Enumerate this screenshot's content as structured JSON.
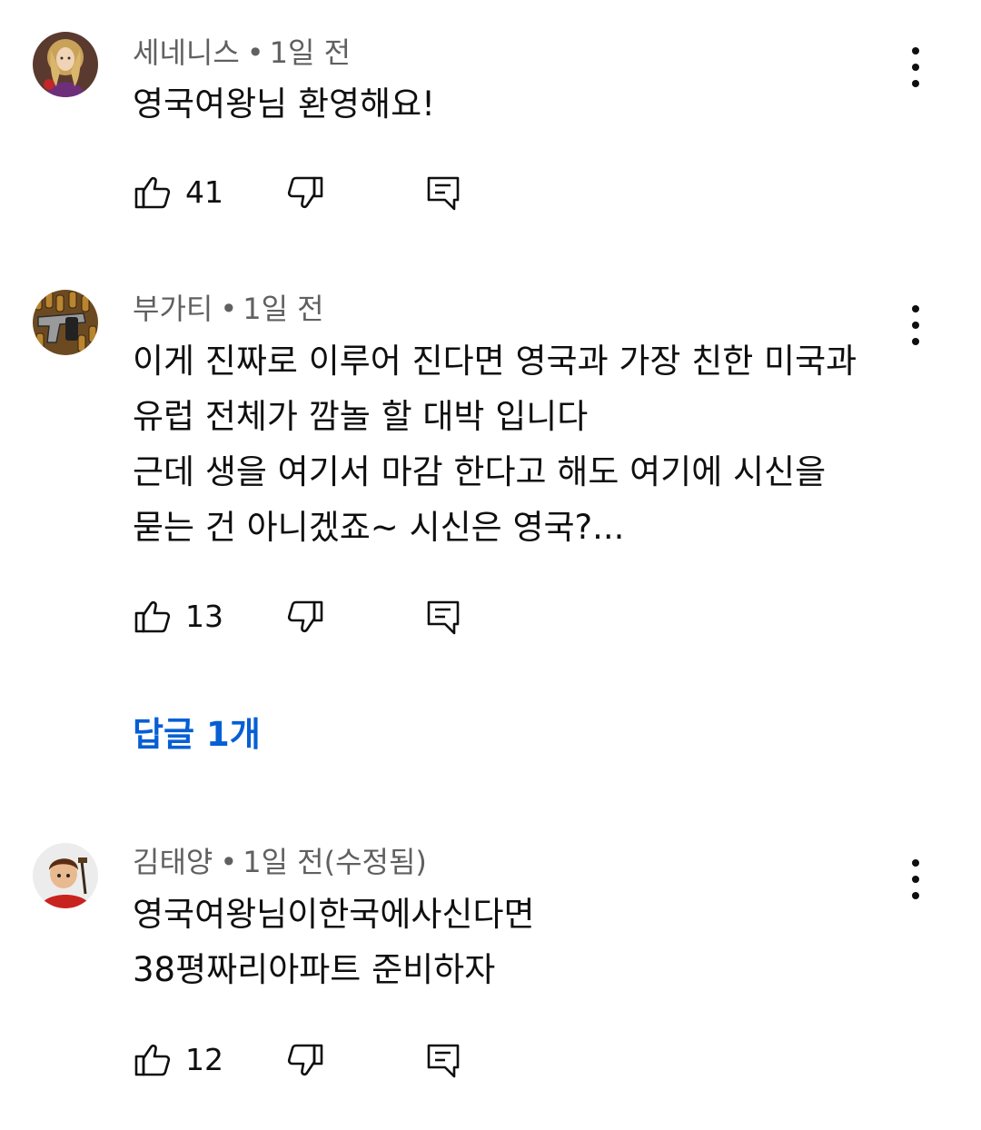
{
  "comments": [
    {
      "author": "세네니스",
      "separator": "•",
      "time": "1일 전",
      "lines": [
        "영국여왕님 환영해요!"
      ],
      "likes": "41",
      "avatar_icon": "avatar-queen-illustration"
    },
    {
      "author": "부가티",
      "separator": "•",
      "time": "1일 전",
      "lines": [
        "이게 진짜로 이루어 진다면 영국과 가장 친한 미국과",
        "유럽 전체가 깜놀 할 대박 입니다",
        "근데 생을 여기서 마감 한다고 해도 여기에 시신을",
        "묻는 건 아니겠죠~ 시신은 영국?..."
      ],
      "likes": "13",
      "avatar_icon": "avatar-pistol-bullets",
      "replies_label": "답글 1개"
    },
    {
      "author": "김태양",
      "separator": "•",
      "time": "1일 전(수정됨)",
      "lines": [
        "영국여왕님이한국에사신다면",
        "38평짜리아파트 준비하자"
      ],
      "likes": "12",
      "avatar_icon": "avatar-cartoon-character"
    }
  ],
  "colors": {
    "text": "#0f0f0f",
    "meta": "#606060",
    "link": "#065fd4",
    "background": "#ffffff"
  },
  "icons": {
    "like": "thumb-up-icon",
    "dislike": "thumb-down-icon",
    "reply": "reply-comment-icon",
    "more": "more-vert-icon"
  }
}
